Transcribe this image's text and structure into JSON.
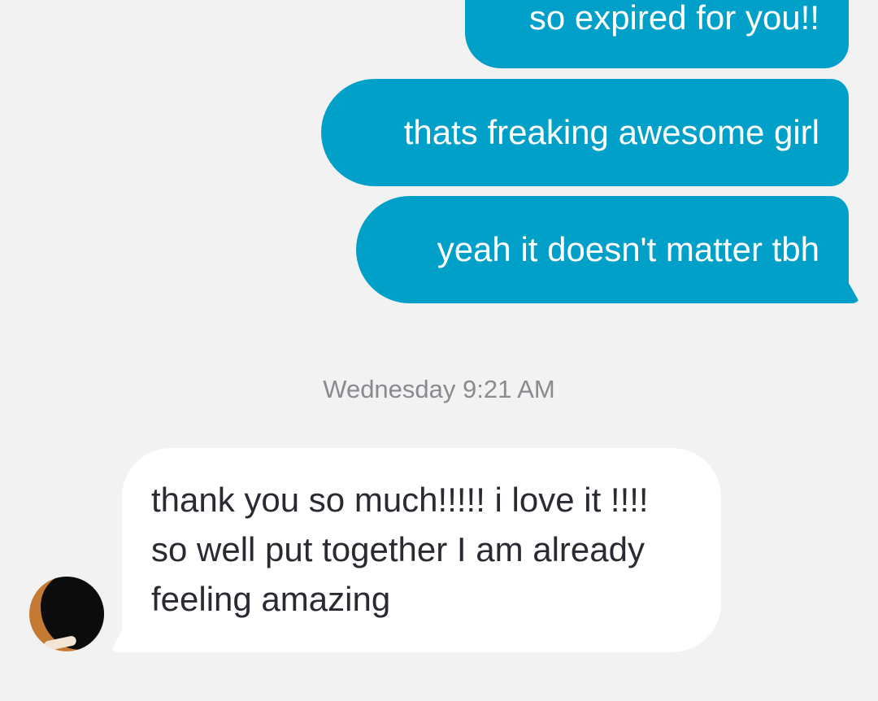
{
  "conversation": {
    "outgoing": [
      {
        "text": "so expired for you!!"
      },
      {
        "text": "thats freaking awesome girl"
      },
      {
        "text": "yeah it doesn't matter tbh"
      }
    ],
    "timestamp": "Wednesday 9:21 AM",
    "incoming": [
      {
        "text": "thank you so much!!!!! i love it !!!! so well put together I am already feeling amazing"
      }
    ]
  },
  "colors": {
    "outgoing_bubble": "#00a0c8",
    "incoming_bubble": "#ffffff",
    "background": "#f2f2f2",
    "timestamp_text": "#8a8a90"
  },
  "icons": {
    "avatar": "contact-avatar"
  }
}
